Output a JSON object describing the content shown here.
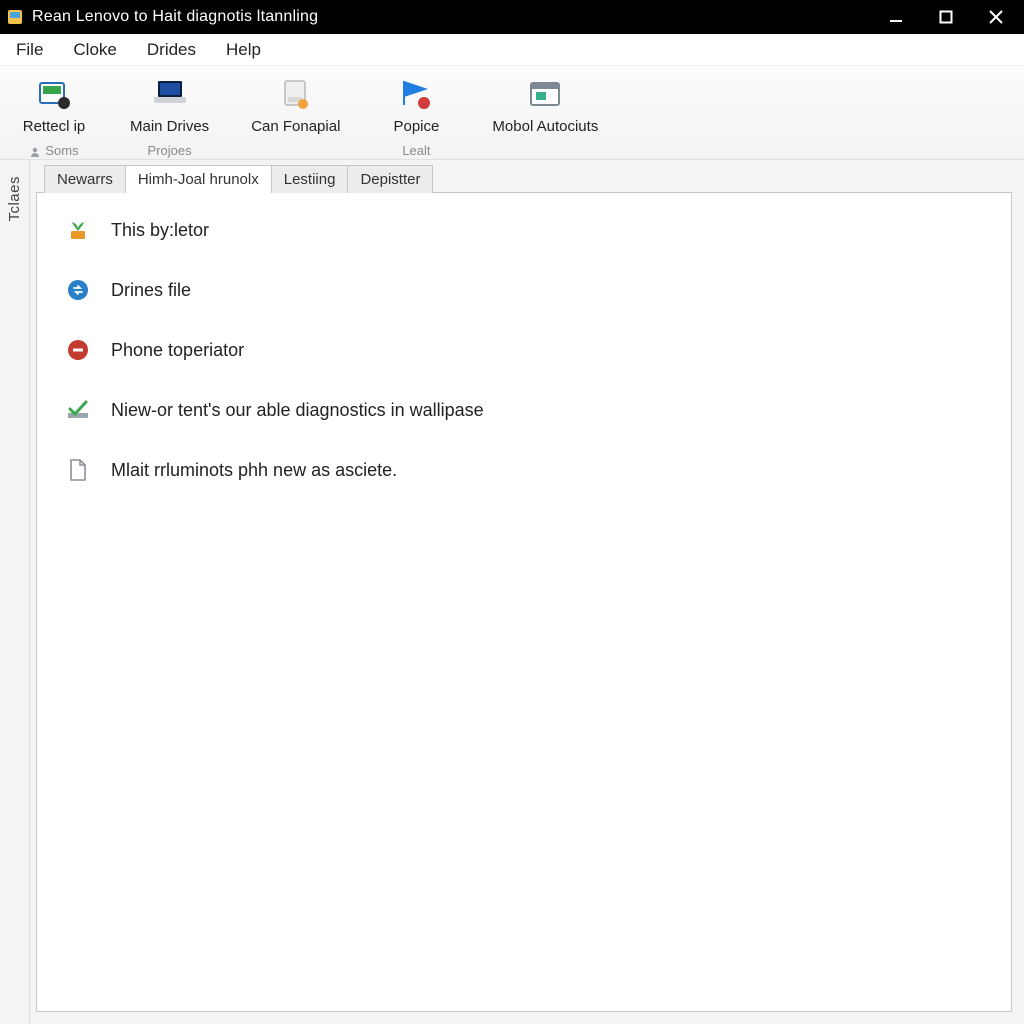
{
  "window": {
    "title": "Rean Lenovo  to Hait diagnotis ltannling"
  },
  "menu": {
    "file": "File",
    "cloke": "Cloke",
    "drides": "Drides",
    "help": "Help"
  },
  "toolbar": {
    "rettecl": {
      "label": "Rettecl ip"
    },
    "main_drives": {
      "label": "Main Drives"
    },
    "can_fonapial": {
      "label": "Can Fonapial"
    },
    "popice": {
      "label": "Popice"
    },
    "mobol": {
      "label": "Mobol Autociuts"
    },
    "group_soms": "Soms",
    "group_projoes": "Projoes",
    "group_lealt": "Lealt"
  },
  "sidebar": {
    "label": "Tclaes"
  },
  "tabs": {
    "newarrs": "Newarrs",
    "himh": "Himh-Joal hrunolx",
    "lestiing": "Lestiing",
    "depistter": "Depistter"
  },
  "items": {
    "i1": "This by:letor",
    "i2": "Drines file",
    "i3": "Phone toperiator",
    "i4": "Niew-or tent's our able diagnostics in wallipase",
    "i5": "Mlait rrluminots phh new as asciete."
  }
}
